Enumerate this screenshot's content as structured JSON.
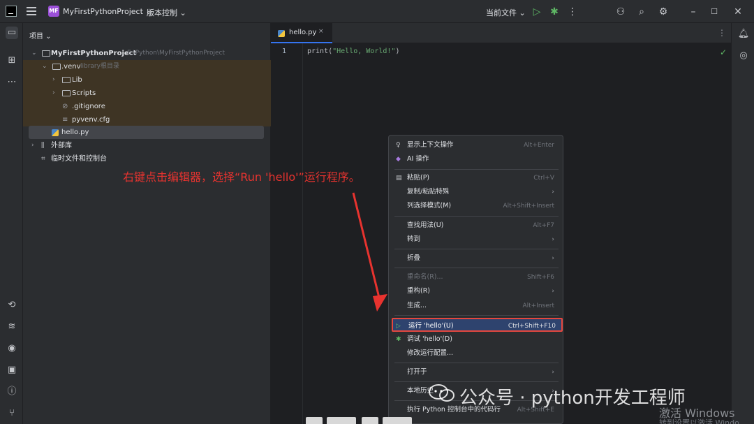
{
  "titlebar": {
    "project_badge": "MF",
    "project_name": "MyFirstPythonProject ⌄",
    "vcs": "版本控制 ⌄",
    "run_config": "当前文件 ⌄"
  },
  "project_panel": {
    "title": "项目 ⌄",
    "tree": {
      "root_name": "MyFirstPythonProject",
      "root_path": "E:\\Python\\MyFirstPythonProject",
      "venv_name": ".venv",
      "venv_hint": "library根目录",
      "lib": "Lib",
      "scripts": "Scripts",
      "gitignore": ".gitignore",
      "pyvenv": "pyvenv.cfg",
      "hello": "hello.py",
      "external": "外部库",
      "scratches": "临时文件和控制台"
    }
  },
  "editor": {
    "tab_label": "hello.py",
    "tab_close": "×",
    "line_number": "1",
    "code_fn": "print(",
    "code_str": "\"Hello, World!\"",
    "code_end": ")"
  },
  "annotation": "右键点击编辑器，选择“Run 'hello'”运行程序。",
  "context_menu": {
    "show_context_actions": "显示上下文操作",
    "show_context_actions_sc": "Alt+Enter",
    "ai_actions": "AI 操作",
    "paste": "粘贴(P)",
    "paste_sc": "Ctrl+V",
    "copy_paste_special": "复制/粘贴特殊",
    "column_selection": "列选择模式(M)",
    "column_selection_sc": "Alt+Shift+Insert",
    "find_usages": "查找用法(U)",
    "find_usages_sc": "Alt+F7",
    "goto": "转到",
    "folding": "折叠",
    "rename": "重命名(R)...",
    "rename_sc": "Shift+F6",
    "refactor": "重构(R)",
    "generate": "生成...",
    "generate_sc": "Alt+Insert",
    "run_hello": "运行 'hello'(U)",
    "run_hello_sc": "Ctrl+Shift+F10",
    "debug_hello": "调试 'hello'(D)",
    "modify_run_config": "修改运行配置...",
    "open_in": "打开于",
    "local_history": "本地历史",
    "execute_in_console": "执行 Python 控制台中的代码行",
    "execute_in_console_sc": "Alt+Shift+E"
  },
  "watermark": "公众号 · python开发工程师",
  "windows_activate": "激活 Windows",
  "windows_activate_sub": "转到设置以激活 Windo"
}
